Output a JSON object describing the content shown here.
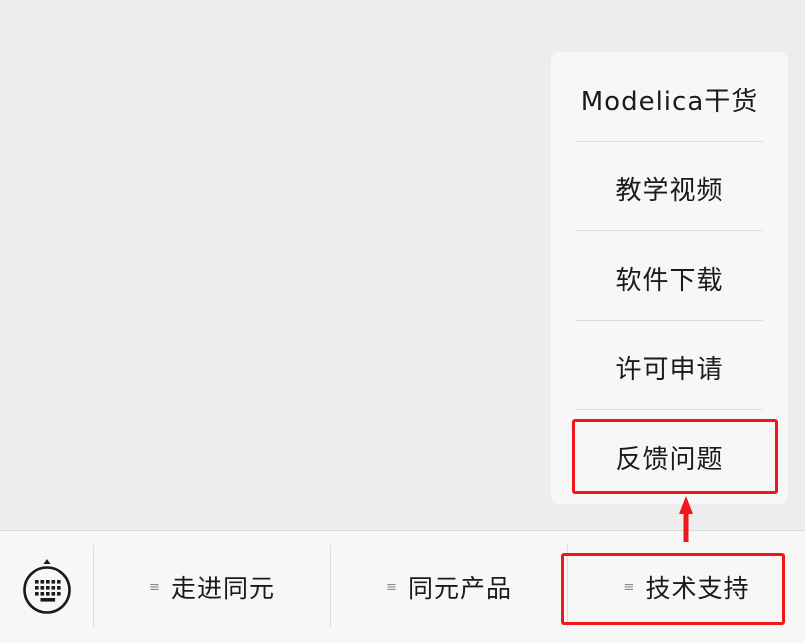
{
  "submenu": {
    "items": [
      {
        "label": "Modelica干货"
      },
      {
        "label": "教学视频"
      },
      {
        "label": "软件下载"
      },
      {
        "label": "许可申请"
      },
      {
        "label": "反馈问题"
      }
    ]
  },
  "menubar": {
    "keyboard_icon": "keyboard-icon",
    "items": [
      {
        "label": "走进同元",
        "icon": "menu-lines-icon"
      },
      {
        "label": "同元产品",
        "icon": "menu-lines-icon"
      },
      {
        "label": "技术支持",
        "icon": "menu-lines-icon"
      }
    ]
  },
  "annotation": {
    "color": "#f2161c"
  }
}
